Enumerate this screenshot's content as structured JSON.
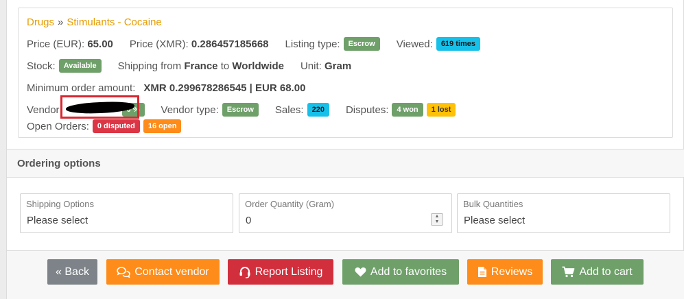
{
  "breadcrumb": {
    "category": "Drugs",
    "separator": "»",
    "subcategory": "Stimulants - Cocaine"
  },
  "listing": {
    "price_eur_label": "Price (EUR):",
    "price_eur": "65.00",
    "price_xmr_label": "Price (XMR):",
    "price_xmr": "0.286457185668",
    "listing_type_label": "Listing type:",
    "listing_type": "Escrow",
    "viewed_label": "Viewed:",
    "viewed": "619 times",
    "stock_label": "Stock:",
    "stock": "Available",
    "shipping_label": "Shipping from",
    "ship_from": "France",
    "to_label": "to",
    "ship_to": "Worldwide",
    "unit_label": "Unit:",
    "unit": "Gram",
    "min_order_label": "Minimum order amount:",
    "min_order": "XMR 0.299678286545 | EUR 68.00",
    "vendor_label": "Vendor",
    "vendor_rating_badge": "0 %",
    "vendor_type_label": "Vendor type:",
    "vendor_type": "Escrow",
    "sales_label": "Sales:",
    "sales": "220",
    "disputes_label": "Disputes:",
    "disputes_won": "4 won",
    "disputes_lost": "1 lost",
    "open_orders_label": "Open Orders:",
    "open_disputed": "0 disputed",
    "open_open": "16 open"
  },
  "ordering": {
    "title": "Ordering options",
    "shipping_options": {
      "label": "Shipping Options",
      "value": "Please select"
    },
    "order_quantity": {
      "label": "Order Quantity (Gram)",
      "value": "0"
    },
    "bulk_quantities": {
      "label": "Bulk Quantities",
      "value": "Please select"
    }
  },
  "buttons": {
    "back": "« Back",
    "contact_vendor": "Contact vendor",
    "report_listing": "Report Listing",
    "add_to_favorites": "Add to favorites",
    "reviews": "Reviews",
    "add_to_cart": "Add to cart"
  },
  "colors": {
    "accent_orange": "#fd8c1a",
    "success_green": "#6fa06a",
    "danger_red": "#d22f3d",
    "info_cyan": "#17c0e8",
    "warning_yellow": "#ffc107",
    "muted_gray": "#7d8388"
  }
}
